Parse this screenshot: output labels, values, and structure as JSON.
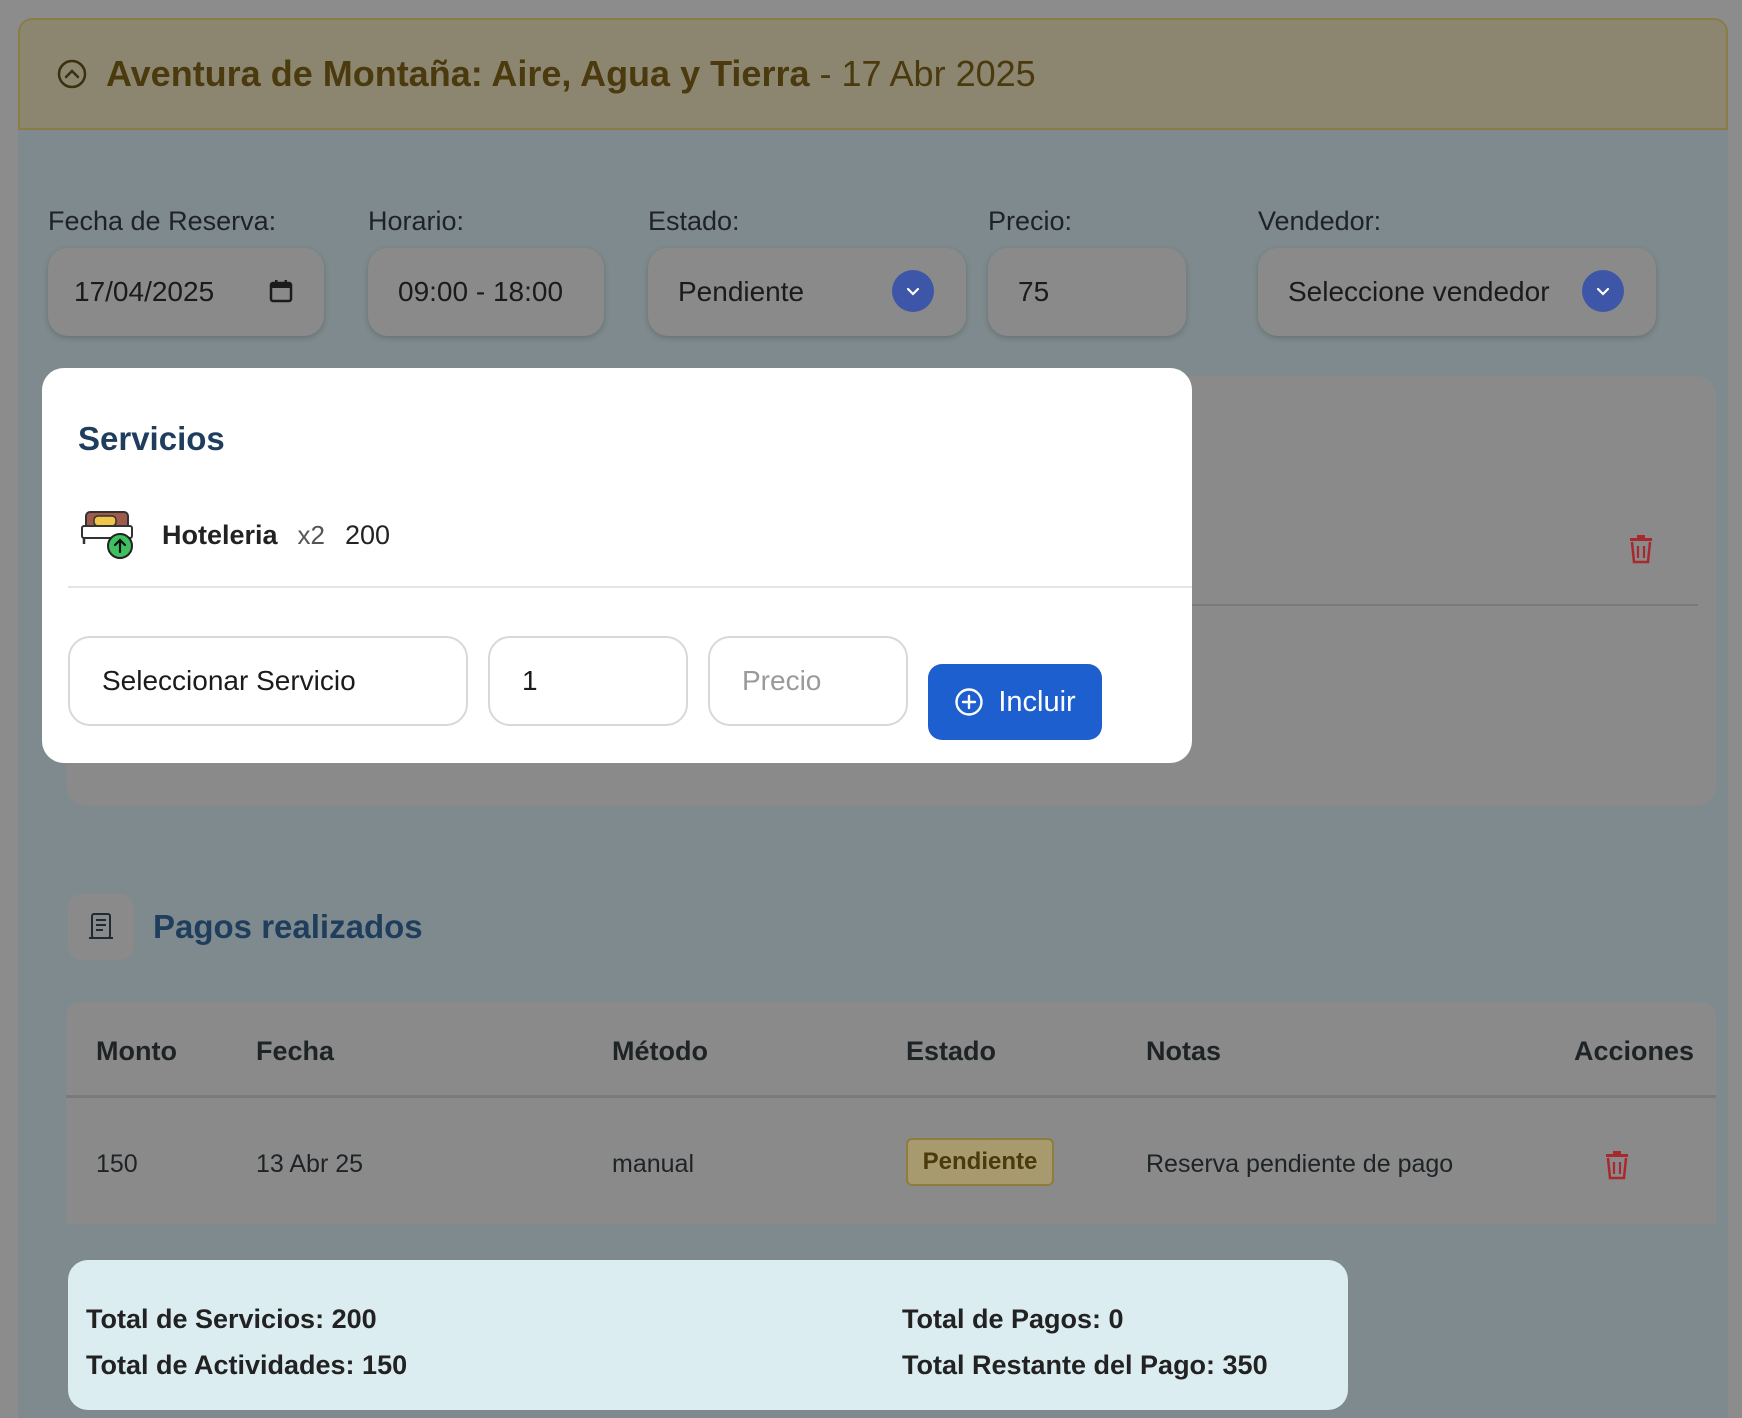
{
  "header": {
    "title": "Aventura de Montaña: Aire, Agua y Tierra",
    "date": "- 17 Abr 2025"
  },
  "form": {
    "fecha": {
      "label": "Fecha de Reserva:",
      "value": "17/04/2025"
    },
    "horario": {
      "label": "Horario:",
      "value": "09:00 - 18:00"
    },
    "estado": {
      "label": "Estado:",
      "value": "Pendiente"
    },
    "precio": {
      "label": "Precio:",
      "value": "75"
    },
    "vendedor": {
      "label": "Vendedor:",
      "value": "Seleccione vendedor"
    }
  },
  "services": {
    "title": "Servicios",
    "items": [
      {
        "name": "Hoteleria",
        "qty": "x2",
        "price": "200",
        "icon": "hotel-bed-icon"
      }
    ],
    "select_placeholder": "Seleccionar Servicio",
    "qty_value": "1",
    "price_placeholder": "Precio",
    "add_label": "Incluir"
  },
  "payments": {
    "title": "Pagos realizados",
    "columns": [
      "Monto",
      "Fecha",
      "Método",
      "Estado",
      "Notas",
      "Acciones"
    ],
    "rows": [
      {
        "monto": "150",
        "fecha": "13 Abr 25",
        "metodo": "manual",
        "estado": "Pendiente",
        "notas": "Reserva pendiente de pago"
      }
    ]
  },
  "totals": {
    "servicios": "Total de Servicios: 200",
    "actividades": "Total de Actividades: 150",
    "pagos": "Total de Pagos: 0",
    "restante": "Total Restante del Pago: 350"
  },
  "colors": {
    "accent": "#1e5fd0",
    "header_bg": "#8c8670",
    "title_blue": "#1f3d5c",
    "danger": "#b3262e"
  }
}
